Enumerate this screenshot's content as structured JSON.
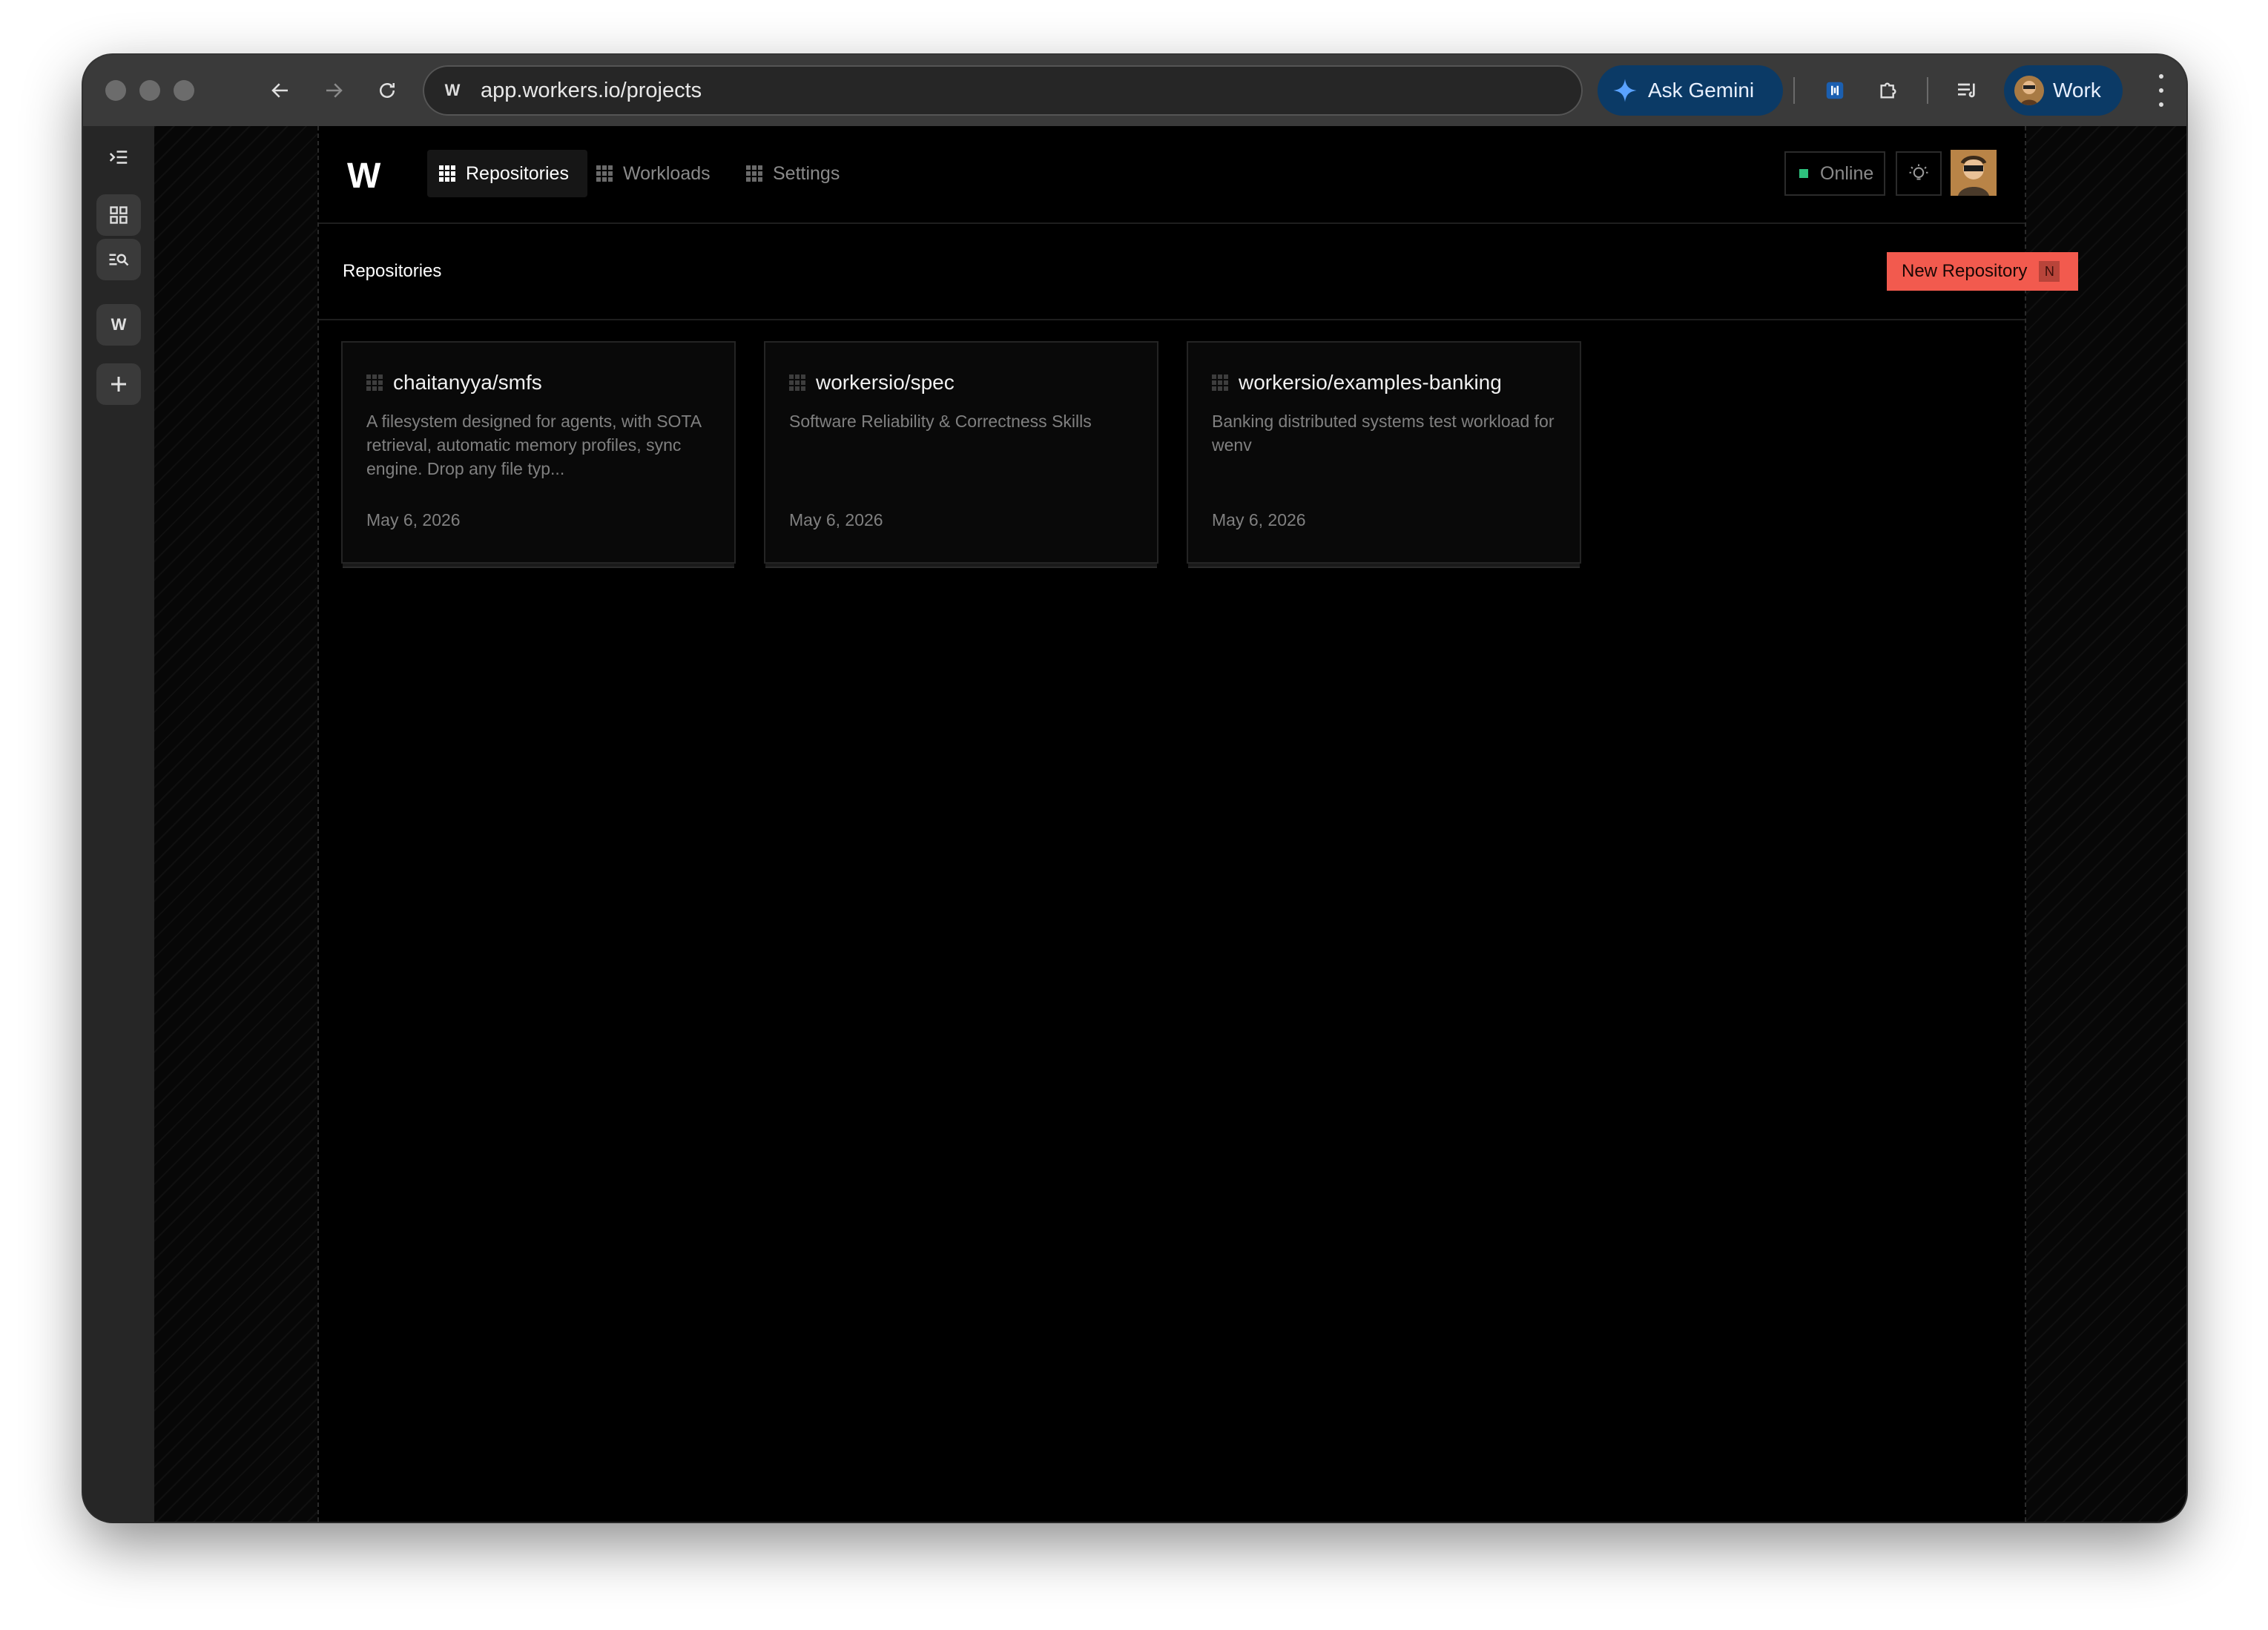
{
  "browser": {
    "url": "app.workers.io/projects",
    "site_letter": "W",
    "gemini_label": "Ask Gemini",
    "profile_label": "Work"
  },
  "side_strip": {
    "tab_letter": "W"
  },
  "app": {
    "logo": "W",
    "nav": [
      {
        "label": "Repositories",
        "active": true
      },
      {
        "label": "Workloads",
        "active": false
      },
      {
        "label": "Settings",
        "active": false
      }
    ],
    "status": "Online",
    "status_color": "#2ec27e"
  },
  "page": {
    "title": "Repositories",
    "new_button": "New Repository",
    "new_button_shortcut": "N",
    "accent": "#f25a4e"
  },
  "repositories": [
    {
      "name": "chaitanyya/smfs",
      "description": "A filesystem designed for agents, with SOTA retrieval, automatic memory profiles, sync engine. Drop any file typ...",
      "date": "May 6, 2026"
    },
    {
      "name": "workersio/spec",
      "description": "Software Reliability & Correctness Skills",
      "date": "May 6, 2026"
    },
    {
      "name": "workersio/examples-banking",
      "description": "Banking distributed systems test workload for wenv",
      "date": "May 6, 2026"
    }
  ]
}
